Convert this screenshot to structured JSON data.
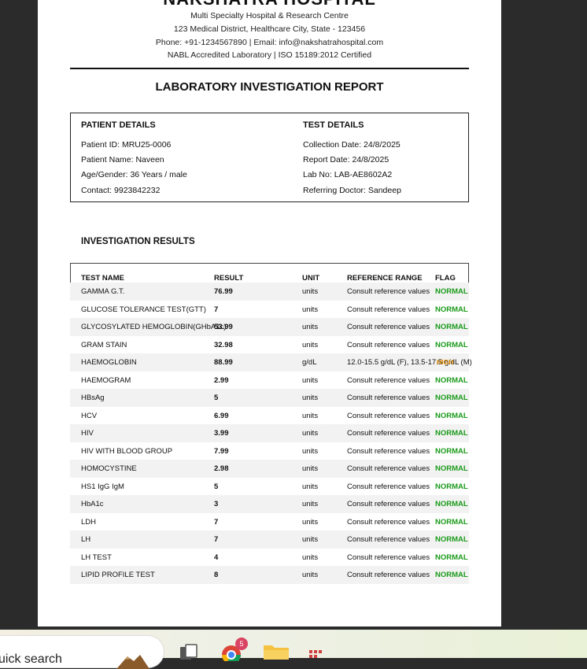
{
  "hospital": {
    "name": "NAKSHATRA HOSPITAL",
    "subtitle": "Multi Specialty Hospital & Research Centre",
    "address": "123 Medical District, Healthcare City, State - 123456",
    "contact": "Phone: +91-1234567890 | Email: info@nakshatrahospital.com",
    "accreditation": "NABL Accredited Laboratory | ISO 15189:2012 Certified"
  },
  "report_title": "LABORATORY INVESTIGATION REPORT",
  "patient": {
    "heading": "PATIENT DETAILS",
    "id": "Patient ID: MRU25-0006",
    "name": "Patient Name: Naveen",
    "age_gender": "Age/Gender: 36 Years / male",
    "contact": "Contact: 9923842232"
  },
  "test": {
    "heading": "TEST DETAILS",
    "collection": "Collection Date: 24/8/2025",
    "report": "Report Date: 24/8/2025",
    "lab_no": "Lab No: LAB-AE8602A2",
    "doctor": "Referring Doctor: Sandeep"
  },
  "results": {
    "heading": "INVESTIGATION RESULTS",
    "columns": [
      "TEST NAME",
      "RESULT",
      "UNIT",
      "REFERENCE RANGE",
      "FLAG"
    ],
    "rows": [
      {
        "name": "GAMMA G.T.",
        "result": "76.99",
        "unit": "units",
        "ref": "Consult reference values",
        "flag": "NORMAL"
      },
      {
        "name": "GLUCOSE TOLERANCE TEST(GTT)",
        "result": "7",
        "unit": "units",
        "ref": "Consult reference values",
        "flag": "NORMAL"
      },
      {
        "name": "GLYCOSYLATED HEMOGLOBIN(GHbA1c)",
        "result": "53.99",
        "unit": "units",
        "ref": "Consult reference values",
        "flag": "NORMAL"
      },
      {
        "name": "GRAM STAIN",
        "result": "32.98",
        "unit": "units",
        "ref": "Consult reference values",
        "flag": "NORMAL"
      },
      {
        "name": "HAEMOGLOBIN",
        "result": "88.99",
        "unit": "g/dL",
        "ref": "12.0-15.5 g/dL (F), 13.5-17.5 g/dL (M)",
        "flag": "HIGH"
      },
      {
        "name": "HAEMOGRAM",
        "result": "2.99",
        "unit": "units",
        "ref": "Consult reference values",
        "flag": "NORMAL"
      },
      {
        "name": "HBsAg",
        "result": "5",
        "unit": "units",
        "ref": "Consult reference values",
        "flag": "NORMAL"
      },
      {
        "name": "HCV",
        "result": "6.99",
        "unit": "units",
        "ref": "Consult reference values",
        "flag": "NORMAL"
      },
      {
        "name": "HIV",
        "result": "3.99",
        "unit": "units",
        "ref": "Consult reference values",
        "flag": "NORMAL"
      },
      {
        "name": "HIV WITH BLOOD GROUP",
        "result": "7.99",
        "unit": "units",
        "ref": "Consult reference values",
        "flag": "NORMAL"
      },
      {
        "name": "HOMOCYSTINE",
        "result": "2.98",
        "unit": "units",
        "ref": "Consult reference values",
        "flag": "NORMAL"
      },
      {
        "name": "HS1 IgG IgM",
        "result": "5",
        "unit": "units",
        "ref": "Consult reference values",
        "flag": "NORMAL"
      },
      {
        "name": "HbA1c",
        "result": "3",
        "unit": "units",
        "ref": "Consult reference values",
        "flag": "NORMAL"
      },
      {
        "name": "LDH",
        "result": "7",
        "unit": "units",
        "ref": "Consult reference values",
        "flag": "NORMAL"
      },
      {
        "name": "LH",
        "result": "7",
        "unit": "units",
        "ref": "Consult reference values",
        "flag": "NORMAL"
      },
      {
        "name": "LH TEST",
        "result": "4",
        "unit": "units",
        "ref": "Consult reference values",
        "flag": "NORMAL"
      },
      {
        "name": "LIPID PROFILE TEST",
        "result": "8",
        "unit": "units",
        "ref": "Consult reference values",
        "flag": "NORMAL"
      }
    ]
  },
  "colors": {
    "normal_flag": "#1a9a1a",
    "high_flag": "#e08a00",
    "row_stripe": "#f2f2f2"
  },
  "taskbar": {
    "search_text": "uick search",
    "chrome_badge": "5",
    "icons": [
      "landscape-icon",
      "task-view-icon",
      "chrome-icon",
      "folder-icon",
      "apps-icon"
    ]
  }
}
